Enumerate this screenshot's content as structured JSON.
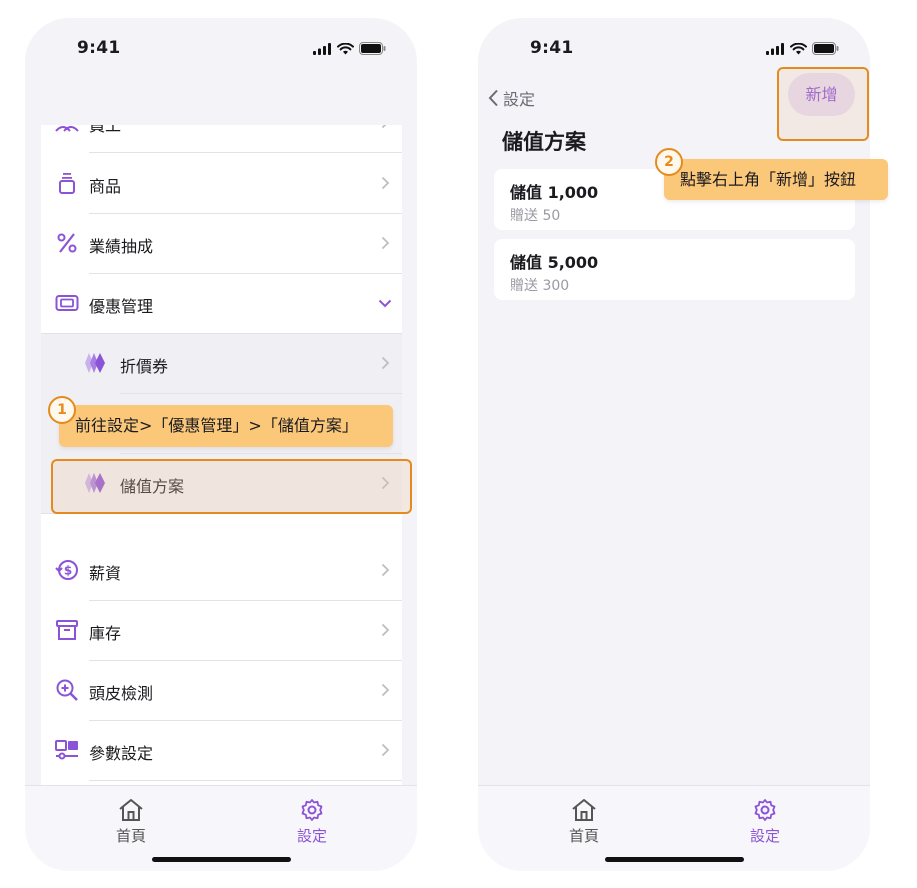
{
  "status_bar": {
    "time": "9:41"
  },
  "left_screen": {
    "menu": [
      {
        "label": "員工",
        "icon": "people-icon"
      },
      {
        "label": "商品",
        "icon": "product-icon"
      },
      {
        "label": "業績抽成",
        "icon": "percent-icon"
      },
      {
        "label": "優惠管理",
        "icon": "ticket-icon",
        "expanded": true
      },
      {
        "label": "折價券",
        "icon": "coupon-diamond-icon",
        "sub": true
      },
      {
        "label": "儲值方案",
        "icon": "stored-value-diamond-icon",
        "sub": true
      },
      {
        "label": "薪資",
        "icon": "salary-icon"
      },
      {
        "label": "庫存",
        "icon": "inventory-icon"
      },
      {
        "label": "頭皮檢測",
        "icon": "scalp-search-icon"
      },
      {
        "label": "參數設定",
        "icon": "parameters-icon"
      }
    ]
  },
  "right_screen": {
    "back_label": "設定",
    "add_button": "新增",
    "title": "儲值方案",
    "plans": [
      {
        "title": "儲值 1,000",
        "bonus": "贈送 50"
      },
      {
        "title": "儲值 5,000",
        "bonus": "贈送 300"
      }
    ]
  },
  "tab_bar": {
    "home": "首頁",
    "settings": "設定"
  },
  "callouts": [
    {
      "step": "1",
      "text": "前往設定>「優惠管理」>「儲值方案」"
    },
    {
      "step": "2",
      "text": "點擊右上角「新增」按鈕"
    }
  ],
  "colors": {
    "accent": "#8b53d6",
    "callout": "#fbc779",
    "highlight_border": "#e58b1e"
  }
}
